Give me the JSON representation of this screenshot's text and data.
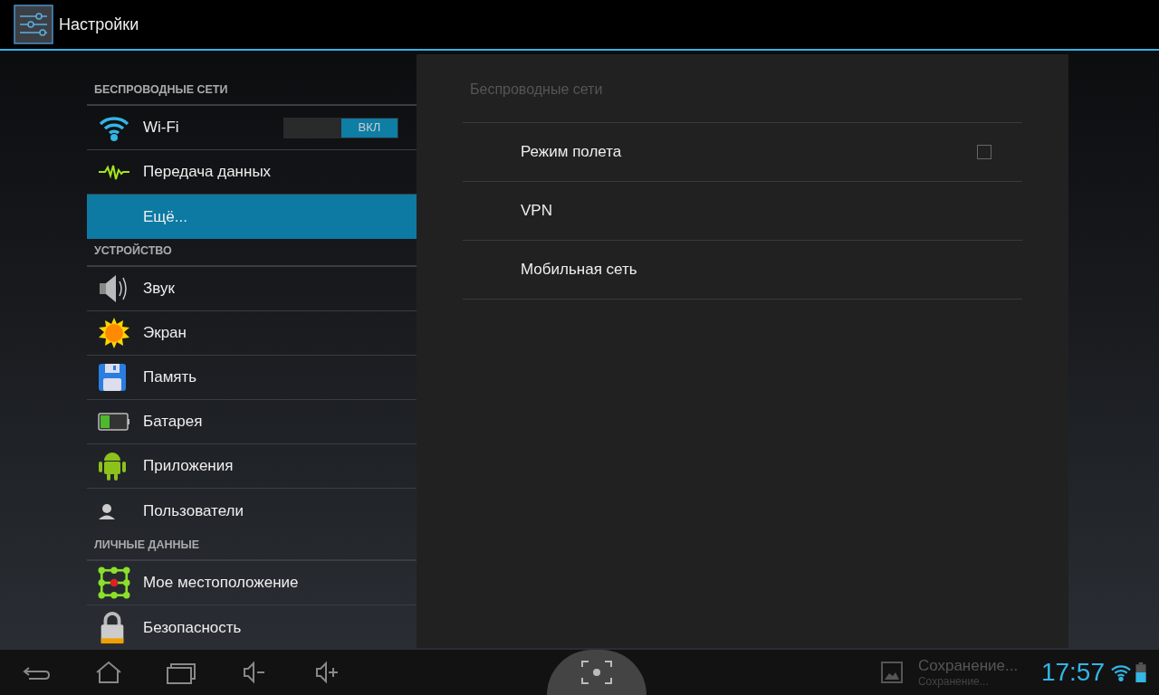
{
  "action_bar": {
    "title": "Настройки"
  },
  "sidebar": {
    "sections": [
      {
        "header": "БЕСПРОВОДНЫЕ СЕТИ",
        "items": [
          {
            "label": "Wi-Fi",
            "selected": false,
            "toggle": {
              "on": true,
              "label": "ВКЛ"
            }
          },
          {
            "label": "Передача данных",
            "selected": false
          },
          {
            "label": "Ещё...",
            "selected": true
          }
        ]
      },
      {
        "header": "УСТРОЙСТВО",
        "items": [
          {
            "label": "Звук",
            "selected": false
          },
          {
            "label": "Экран",
            "selected": false
          },
          {
            "label": "Память",
            "selected": false
          },
          {
            "label": "Батарея",
            "selected": false
          },
          {
            "label": "Приложения",
            "selected": false
          },
          {
            "label": "Пользователи",
            "selected": false
          }
        ]
      },
      {
        "header": "ЛИЧНЫЕ ДАННЫЕ",
        "items": [
          {
            "label": "Мое местоположение",
            "selected": false
          },
          {
            "label": "Безопасность",
            "selected": false
          }
        ]
      }
    ]
  },
  "detail": {
    "title": "Беспроводные сети",
    "rows": [
      {
        "kind": "checkbox",
        "label": "Режим полета",
        "checked": false
      },
      {
        "kind": "plain",
        "label": "VPN"
      },
      {
        "kind": "plain",
        "label": "Мобильная сеть"
      }
    ]
  },
  "system_bar": {
    "notification": {
      "title": "Сохранение...",
      "subtitle": "Сохранение..."
    },
    "time": "17:57"
  }
}
